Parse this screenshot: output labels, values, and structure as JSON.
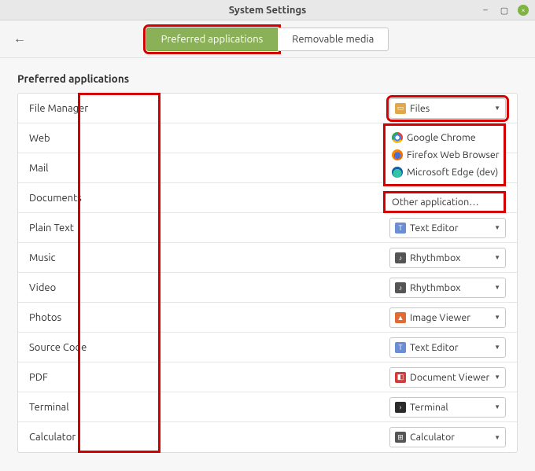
{
  "window": {
    "title": "System Settings"
  },
  "header": {
    "tabs": {
      "preferred": "Preferred applications",
      "removable": "Removable media"
    }
  },
  "section_title": "Preferred applications",
  "rows": {
    "file_manager": {
      "label": "File Manager",
      "value": "Files"
    },
    "web": {
      "label": "Web"
    },
    "mail": {
      "label": "Mail"
    },
    "documents": {
      "label": "Documents"
    },
    "plain_text": {
      "label": "Plain Text",
      "value": "Text Editor"
    },
    "music": {
      "label": "Music",
      "value": "Rhythmbox"
    },
    "video": {
      "label": "Video",
      "value": "Rhythmbox"
    },
    "photos": {
      "label": "Photos",
      "value": "Image Viewer"
    },
    "source_code": {
      "label": "Source Code",
      "value": "Text Editor"
    },
    "pdf": {
      "label": "PDF",
      "value": "Document Viewer"
    },
    "terminal": {
      "label": "Terminal",
      "value": "Terminal"
    },
    "calculator": {
      "label": "Calculator",
      "value": "Calculator"
    }
  },
  "web_popup": {
    "items": [
      "Google Chrome",
      "Firefox Web Browser",
      "Microsoft Edge (dev)"
    ],
    "other": "Other application…"
  }
}
